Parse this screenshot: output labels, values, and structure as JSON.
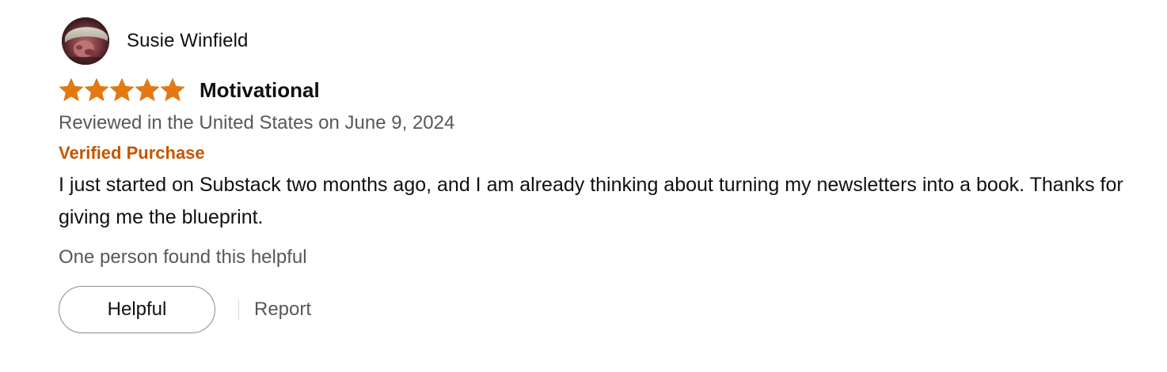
{
  "reviewer": {
    "name": "Susie Winfield",
    "avatar_icon": "user-avatar-photo"
  },
  "rating": {
    "stars": 5,
    "max_stars": 5,
    "star_color": "#e47911"
  },
  "review": {
    "title": "Motivational",
    "date_line": "Reviewed in the United States on June 9, 2024",
    "verified_label": "Verified Purchase",
    "body": "I just started on Substack two months ago, and I am already thinking about turning my newsletters into a book. Thanks for giving me the blueprint.",
    "helpful_count_text": "One person found this helpful"
  },
  "actions": {
    "helpful_label": "Helpful",
    "report_label": "Report"
  },
  "colors": {
    "verified": "#c45500",
    "secondary_text": "#565959",
    "primary_text": "#0f1111"
  }
}
